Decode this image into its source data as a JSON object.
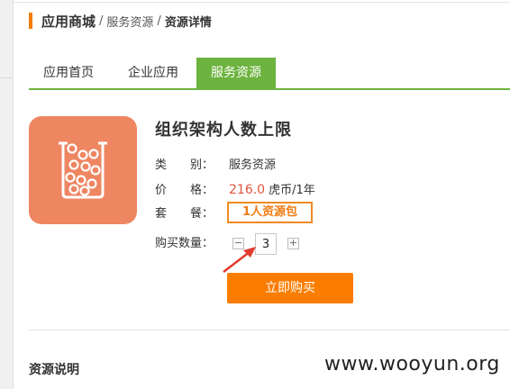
{
  "breadcrumb": {
    "root": "应用商城",
    "separator": "/",
    "level1": "服务资源",
    "level2": "资源详情"
  },
  "tabs": [
    {
      "label": "应用首页",
      "active": false
    },
    {
      "label": "企业应用",
      "active": false
    },
    {
      "label": "服务资源",
      "active": true
    }
  ],
  "product": {
    "icon": "test-tube-beads-icon",
    "icon_bg_color": "#ee8662",
    "title": "组织架构人数上限",
    "category_label": "类　　别：",
    "category_value": "服务资源",
    "price_label": "价　　格：",
    "price_value": "216.0",
    "price_unit": "虎币/1年",
    "package_label": "套　　餐：",
    "package_value": "1人资源包",
    "quantity_label": "购买数量：",
    "quantity_value": "3",
    "buy_label": "立即购买"
  },
  "section": {
    "title": "资源说明"
  },
  "watermark": "www.wooyun.org",
  "colors": {
    "accent_green": "#6db33f",
    "accent_orange": "#fa7d00",
    "price_red": "#e2543d"
  }
}
